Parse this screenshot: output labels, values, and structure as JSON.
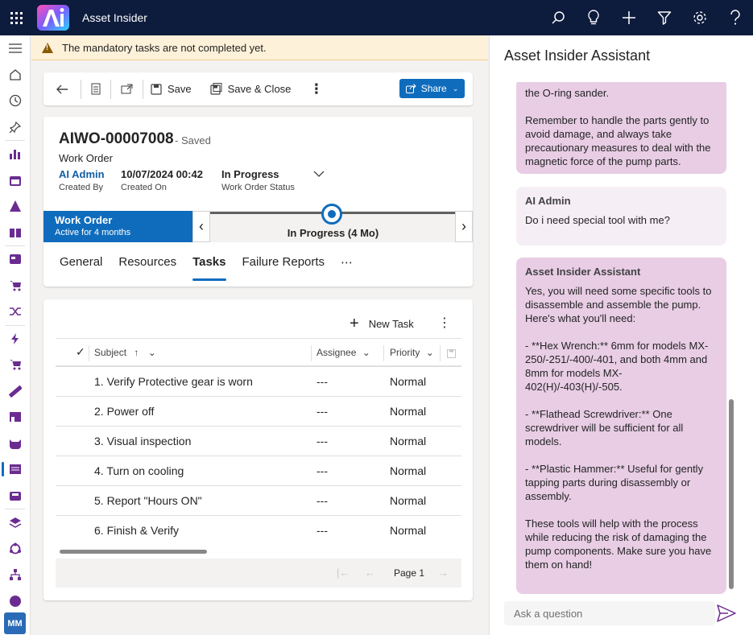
{
  "app": {
    "title": "Asset Insider",
    "avatar_initials": "MM"
  },
  "topbar_icons": [
    "search-icon",
    "lightbulb-icon",
    "plus-icon",
    "filter-icon",
    "gear-icon",
    "help-icon"
  ],
  "nav_icons": [
    "hamburger-icon",
    "home-icon",
    "recent-icon",
    "pin-icon",
    "chart-icon",
    "calendar-icon",
    "warning-icon",
    "book-icon",
    "cards-icon",
    "cart-icon",
    "shuffle-icon",
    "lightning-icon",
    "cart-plus-icon",
    "ruler-icon",
    "store-icon",
    "cat-icon",
    "list-icon",
    "inbox-icon",
    "layers-icon",
    "cycle-icon",
    "hierarchy-icon",
    "globe-icon"
  ],
  "warning": {
    "text": "The mandatory tasks are not completed yet."
  },
  "commandbar": {
    "save": "Save",
    "save_close": "Save & Close",
    "share": "Share"
  },
  "record": {
    "title": "AIWO-00007008",
    "status_saved": "- Saved",
    "entity": "Work Order",
    "created_by": {
      "value": "AI Admin",
      "label": "Created By"
    },
    "created_on": {
      "value": "10/07/2024 00:42",
      "label": "Created On"
    },
    "status": {
      "value": "In Progress",
      "label": "Work Order Status"
    }
  },
  "bpf": {
    "stage": "Work Order",
    "stage_sub": "Active for 4 months",
    "current": "In Progress  (4 Mo)"
  },
  "tabs": [
    "General",
    "Resources",
    "Tasks",
    "Failure Reports",
    "⋯"
  ],
  "grid": {
    "new_task": "New Task",
    "columns": {
      "subject": "Subject",
      "assignee": "Assignee",
      "priority": "Priority"
    },
    "rows": [
      {
        "subject": "1. Verify Protective gear is worn",
        "assignee": "---",
        "priority": "Normal"
      },
      {
        "subject": "2. Power off",
        "assignee": "---",
        "priority": "Normal"
      },
      {
        "subject": "3. Visual inspection",
        "assignee": "---",
        "priority": "Normal"
      },
      {
        "subject": "4. Turn on cooling",
        "assignee": "---",
        "priority": "Normal"
      },
      {
        "subject": "5. Report \"Hours ON\"",
        "assignee": "---",
        "priority": "Normal"
      },
      {
        "subject": "6. Finish & Verify",
        "assignee": "---",
        "priority": "Normal"
      }
    ],
    "page": "Page 1"
  },
  "assistant": {
    "title": "Asset Insider Assistant",
    "messages": [
      {
        "from": "bot",
        "name": "",
        "text": "the O-ring sander.\n\nRemember to handle the parts gently to avoid damage, and always take precautionary measures to deal with the magnetic force of the pump parts."
      },
      {
        "from": "user",
        "name": "AI Admin",
        "text": "Do i need special tool with me?"
      },
      {
        "from": "bot",
        "name": "Asset Insider Assistant",
        "text": "Yes, you will need some specific tools to disassemble and assemble the pump. Here's what you'll need:\n\n- **Hex Wrench:** 6mm for models MX-250/-251/-400/-401, and both 4mm and 8mm for models MX-402(H)/-403(H)/-505.\n\n- **Flathead Screwdriver:** One screwdriver will be sufficient for all models.\n\n- **Plastic Hammer:** Useful for gently tapping parts during disassembly or assembly.\n\nThese tools will help with the process while reducing the risk of damaging the pump components. Make sure you have them on hand!"
      }
    ],
    "input_placeholder": "Ask a question"
  },
  "colors": {
    "topbar": "#0d1b3d",
    "accent": "#0f6cbd",
    "warning_bg": "#fdf1d9",
    "bot_bubble": "#e8cde5"
  }
}
